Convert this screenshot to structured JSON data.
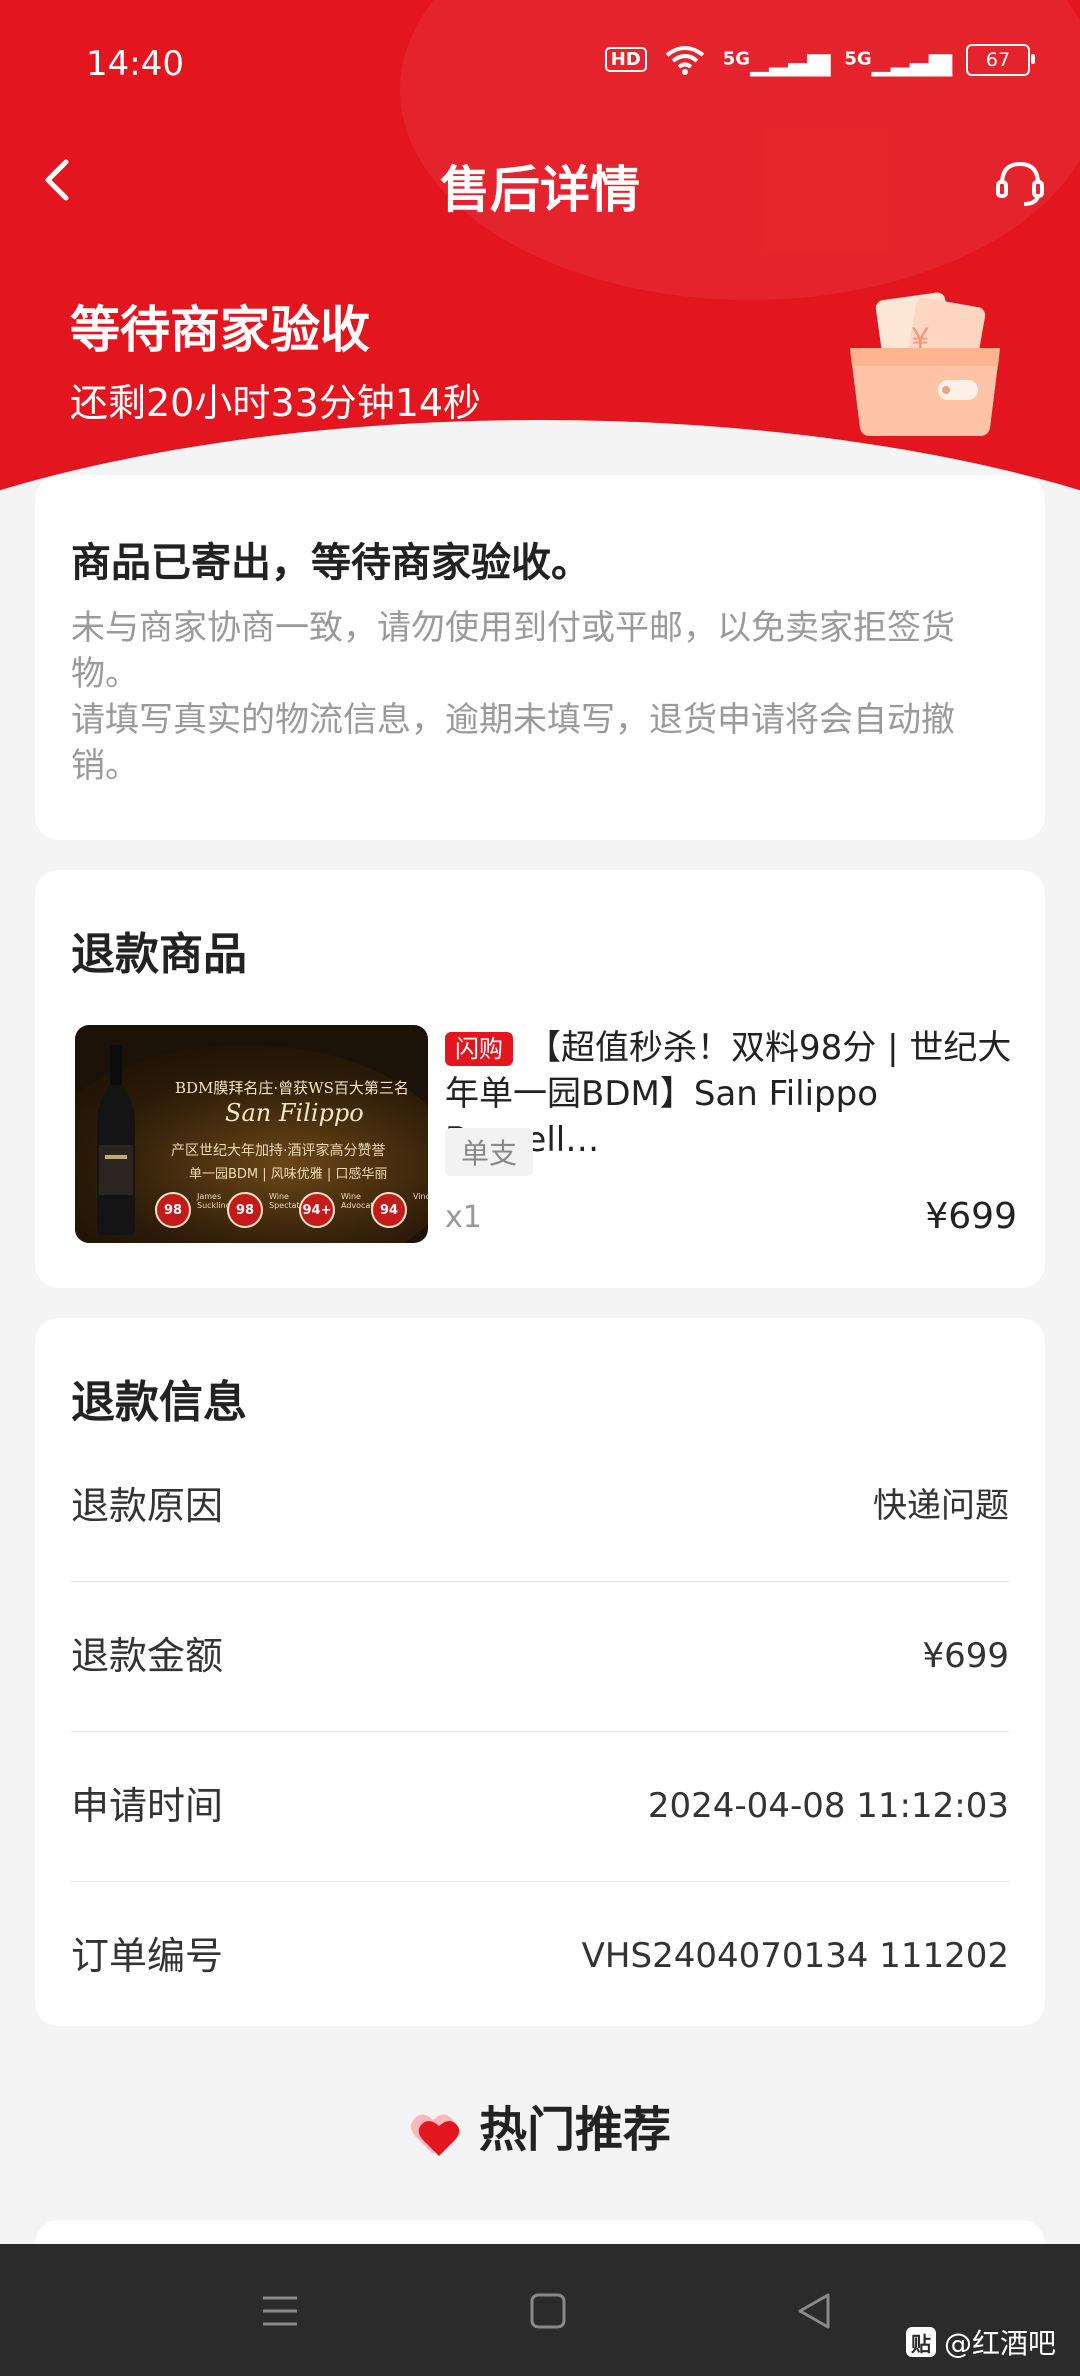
{
  "status_bar": {
    "time": "14:40",
    "hd": "HD",
    "net1": "5G",
    "net2": "5G",
    "battery": "67"
  },
  "nav": {
    "title": "售后详情"
  },
  "header": {
    "status_title": "等待商家验收",
    "countdown": "还剩20小时33分钟14秒"
  },
  "notice": {
    "title": "商品已寄出，等待商家验收。",
    "lines": [
      "未与商家协商一致，请勿使用到付或平邮，以免卖家拒签货",
      "物。",
      "请填写真实的物流信息，逾期未填写，退货申请将会自动撤",
      "销。"
    ]
  },
  "refund_goods": {
    "title": "退款商品",
    "product": {
      "tag": "闪购",
      "name": "【超值秒杀！双料98分 | 世纪大年单一园BDM】San Filippo Brunell…",
      "spec": "单支",
      "qty": "x1",
      "price": "¥699",
      "image_text": {
        "line1": "BDM膜拜名庄·曾获WS百大第三名",
        "line2": "San Filippo",
        "line3": "产区世纪大年加持·酒评家高分赞誉",
        "line4": "单一园BDM | 风味优雅 | 口感华丽",
        "badges": [
          "98",
          "98",
          "94+",
          "94"
        ],
        "badge_labels": [
          "James Suckling",
          "Wine Spectator",
          "Wine Advocate",
          "Vinous"
        ]
      }
    }
  },
  "refund_info": {
    "title": "退款信息",
    "rows": [
      {
        "label": "退款原因",
        "value": "快递问题"
      },
      {
        "label": "退款金额",
        "value": "¥699"
      },
      {
        "label": "申请时间",
        "value": "2024-04-08 11:12:03"
      },
      {
        "label": "订单编号",
        "value": "VHS2404070134 111202"
      }
    ]
  },
  "recommend": {
    "title": "热门推荐"
  },
  "watermark": {
    "logo": "贴",
    "text": "@红酒吧"
  },
  "colors": {
    "brand_red": "#e3161f",
    "background": "#f4f4f4",
    "sys_bar": "#2b2b2b"
  }
}
